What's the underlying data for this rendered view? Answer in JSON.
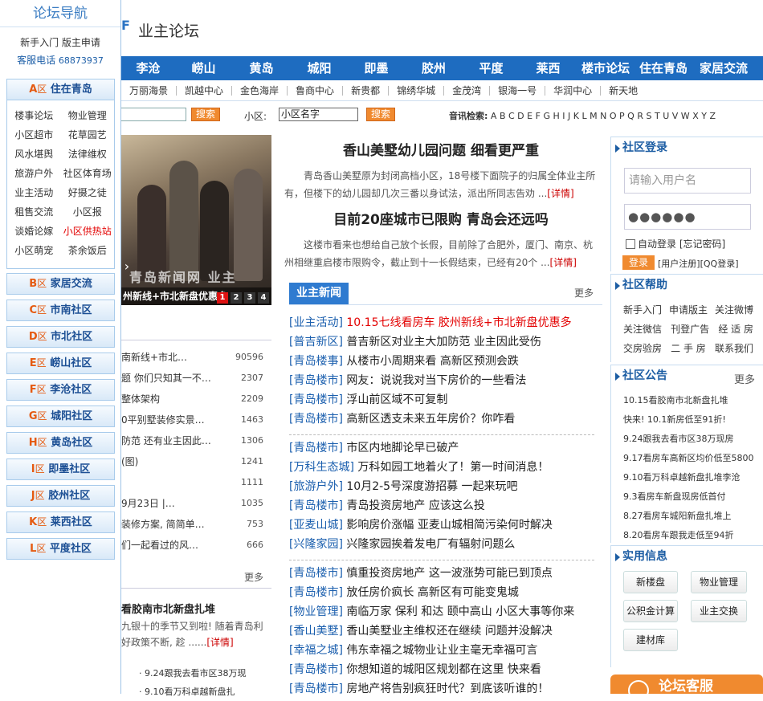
{
  "sidebar": {
    "title": "论坛导航",
    "link1": "新手入门",
    "link2": "版主申请",
    "phone_label": "客服电话",
    "phone": "68873937",
    "zone_a": {
      "letter": "A",
      "qu": "区",
      "name": "住在青岛",
      "rows": [
        [
          "楼事论坛",
          "物业管理"
        ],
        [
          "小区超市",
          "花草园艺"
        ],
        [
          "风水堪舆",
          "法律维权"
        ],
        [
          "旅游户外",
          "社区体育场"
        ],
        [
          "业主活动",
          "好摄之徒"
        ],
        [
          "租售交流",
          "小区报"
        ],
        [
          "谈婚论嫁",
          "小区供热站"
        ],
        [
          "小区萌宠",
          "茶余饭后"
        ]
      ]
    },
    "zones": [
      {
        "letter": "B",
        "qu": "区",
        "name": "家居交流"
      },
      {
        "letter": "C",
        "qu": "区",
        "name": "市南社区"
      },
      {
        "letter": "D",
        "qu": "区",
        "name": "市北社区"
      },
      {
        "letter": "E",
        "qu": "区",
        "name": "崂山社区"
      },
      {
        "letter": "F",
        "qu": "区",
        "name": "李沧社区"
      },
      {
        "letter": "G",
        "qu": "区",
        "name": "城阳社区"
      },
      {
        "letter": "H",
        "qu": "区",
        "name": "黄岛社区"
      },
      {
        "letter": "I",
        "qu": "区",
        "name": "即墨社区"
      },
      {
        "letter": "J",
        "qu": "区",
        "name": "胶州社区"
      },
      {
        "letter": "K",
        "qu": "区",
        "name": "莱西社区"
      },
      {
        "letter": "L",
        "qu": "区",
        "name": "平度社区"
      }
    ]
  },
  "header": {
    "mark": "F",
    "title": "业主论坛"
  },
  "nav": [
    "李沧",
    "崂山",
    "黄岛",
    "城阳",
    "即墨",
    "胶州",
    "平度",
    "莱西",
    "楼市论坛",
    "住在青岛",
    "家居交流"
  ],
  "subnav": [
    "万丽海景",
    "凯越中心",
    "金色海岸",
    "鲁商中心",
    "新贵都",
    "锦绣华城",
    "金茂湾",
    "银海一号",
    "华润中心",
    "新天地"
  ],
  "search": {
    "btn1": "搜索",
    "community_label": "小区:",
    "community_value": "小区名字",
    "btn2": "搜索",
    "letters_label": "音讯检索:",
    "letters": [
      "A",
      "B",
      "C",
      "D",
      "E",
      "F",
      "G",
      "H",
      "I",
      "J",
      "K",
      "L",
      "M",
      "N",
      "O",
      "P",
      "Q",
      "R",
      "S",
      "T",
      "U",
      "V",
      "W",
      "X",
      "Y",
      "Z"
    ]
  },
  "photo": {
    "caption": "州新线+市北新盘优惠多",
    "watermark": "青岛新闻网 业主",
    "pages": [
      "1",
      "2",
      "3",
      "4"
    ]
  },
  "headline1": {
    "title": "香山美墅幼儿园问题 细看更严重",
    "text": "青岛香山美墅原为封闭高档小区，18号楼下面院子的归属全体业主所有，但楼下的幼儿园却几次三番以身试法，派出所同志告劝 ...",
    "more": "[详情]"
  },
  "headline2": {
    "title": "目前20座城市已限购 青岛会还远吗",
    "text": "这楼市看来也想给自己放个长假，目前除了合肥外，厦门、南京、杭州相继重启楼市限购令，截止到十一长假结束，已经有20个 ...",
    "more": "[详情]"
  },
  "left_list": [
    {
      "t": "南新线+市北…",
      "c": "90596"
    },
    {
      "t": "题 你们只知其一不…",
      "c": "2307"
    },
    {
      "t": "整体架构",
      "c": "2209"
    },
    {
      "t": "0平别墅装修实景…",
      "c": "1463"
    },
    {
      "t": "防范 还有业主因此…",
      "c": "1306"
    },
    {
      "t": "(图)",
      "c": "1241"
    },
    {
      "t": "",
      "c": "1111"
    },
    {
      "t": "9月23日 |…",
      "c": "1035"
    },
    {
      "t": "装修方案, 简简单…",
      "c": "753"
    },
    {
      "t": "们一起看过的风…",
      "c": "666"
    }
  ],
  "left_bottom": {
    "more": "更多",
    "title": "看胶南市北新盘扎堆",
    "text": "九银十的季节又到啦! 随着青岛利好政策不断, 趁",
    "dots": " ......",
    "more2": "[详情]",
    "mini1": "· 9.24跟我去看市区38万现",
    "mini2": "· 9.10看万科卓越新盘扎"
  },
  "news": {
    "tab": "业主新闻",
    "more": "更多",
    "sec1": [
      {
        "cat": "[业主活动]",
        "t": "10.15七线看房车 胶州新线+市北新盘优惠多",
        "red": true
      },
      {
        "cat": "[普吉新区]",
        "t": "普吉新区对业主大加防范 业主因此受伤"
      },
      {
        "cat": "[青岛楼事]",
        "t": "从楼市小周期来看 高新区预测会跌"
      },
      {
        "cat": "[青岛楼市]",
        "t": "网友：说说我对当下房价的一些看法"
      },
      {
        "cat": "[青岛楼市]",
        "t": "浮山前区域不可复制"
      },
      {
        "cat": "[青岛楼市]",
        "t": "高新区透支未来五年房价？你咋看"
      }
    ],
    "sec2": [
      {
        "cat": "[青岛楼市]",
        "t": "市区内地脚论早已破产"
      },
      {
        "cat": "[万科生态城]",
        "t": "万科如园工地着火了！第一时间消息！"
      },
      {
        "cat": "[旅游户外]",
        "t": "10月2-5号深度游招募 一起来玩吧"
      },
      {
        "cat": "[青岛楼市]",
        "t": "青岛投资房地产 应该这么投"
      },
      {
        "cat": "[亚麦山城]",
        "t": "影响房价涨幅 亚麦山城相简污染何时解决"
      },
      {
        "cat": "[兴隆家园]",
        "t": "兴隆家园挨着发电厂有辐射问题么"
      }
    ],
    "sec3": [
      {
        "cat": "[青岛楼市]",
        "t": "慎重投资房地产 这一波涨势可能已到顶点"
      },
      {
        "cat": "[青岛楼市]",
        "t": "放任房价疯长 高新区有可能变鬼城"
      },
      {
        "cat": "[物业管理]",
        "t": "南临万家 保利 和达 颐中高山 小区大事等你来"
      },
      {
        "cat": "[香山美墅]",
        "t": "香山美墅业主维权还在继续 问题并没解决"
      },
      {
        "cat": "[幸福之城]",
        "t": "伟东幸福之城物业让业主毫无幸福可言"
      },
      {
        "cat": "[青岛楼市]",
        "t": "你想知道的城阳区规划都在这里 快来看"
      },
      {
        "cat": "[青岛楼市]",
        "t": "房地产将告别疯狂时代？到底该听谁的！"
      }
    ]
  },
  "login": {
    "title": "社区登录",
    "user_placeholder": "请输入用户名",
    "password_dots": "●●●●●●",
    "auto": "自动登录",
    "forgot": "[忘记密码]",
    "btn": "登录",
    "reg": "[用户注册]",
    "qq": "[QQ登录]"
  },
  "help": {
    "title": "社区帮助",
    "rows": [
      [
        "新手入门",
        "申请版主",
        "关注微博"
      ],
      [
        "关注微信",
        "刊登广告",
        "经 适 房"
      ],
      [
        "交房验房",
        "二 手 房",
        "联系我们"
      ]
    ]
  },
  "notice": {
    "title": "社区公告",
    "more": "更多",
    "items": [
      "10.15看胶南市北新盘扎堆",
      "快来! 10.1新房低至91折!",
      "9.24跟我去看市区38万现房",
      "9.17看房车高新区均价低至5800",
      "9.10看万科卓越新盘扎堆李沧",
      "9.3看房车新盘现房低首付",
      "8.27看房车城阳新盘扎堆上",
      "8.20看房车跟我走低至94折"
    ]
  },
  "info": {
    "title": "实用信息",
    "btns": [
      "新楼盘",
      "物业管理",
      "公积金计算",
      "业主交换",
      "建材库"
    ]
  },
  "kefu": {
    "label": "论坛客服"
  },
  "colors": {
    "nav_blue": "#1e6cc0",
    "accent_orange": "#f08a2f",
    "link_blue": "#1b5fae",
    "hot_red": "#e30000"
  }
}
